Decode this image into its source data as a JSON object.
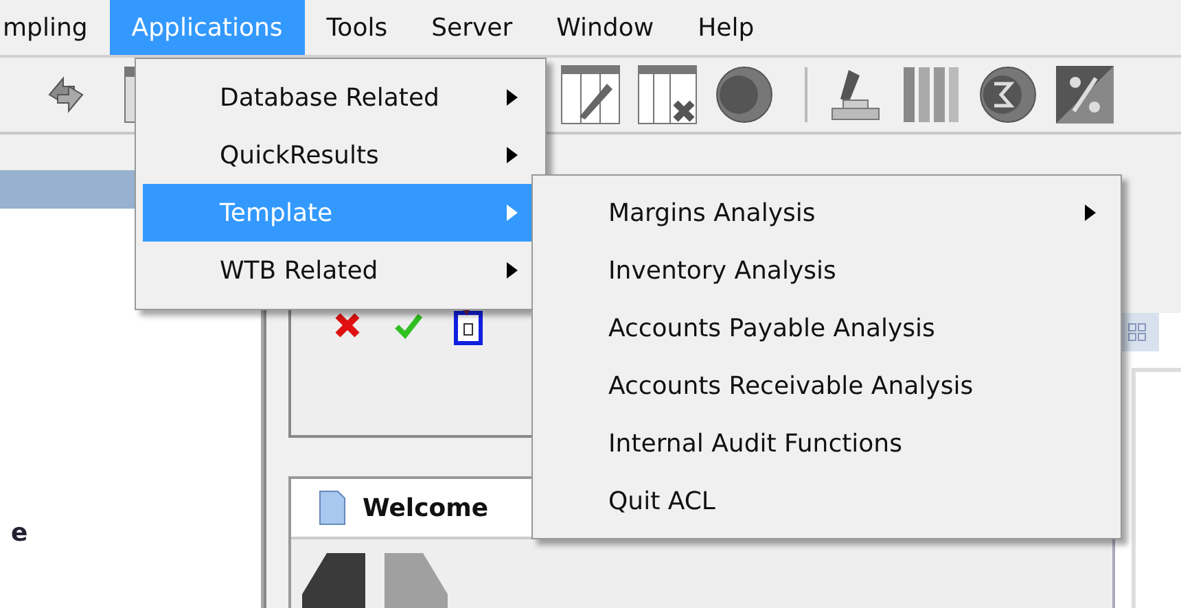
{
  "menubar": [
    {
      "label": "mpling",
      "selected": false
    },
    {
      "label": "Applications",
      "selected": true
    },
    {
      "label": "Tools",
      "selected": false
    },
    {
      "label": "Server",
      "selected": false
    },
    {
      "label": "Window",
      "selected": false
    },
    {
      "label": "Help",
      "selected": false
    }
  ],
  "applications_menu": [
    {
      "label": "Database Related",
      "selected": false,
      "has_submenu": true
    },
    {
      "label": "QuickResults",
      "selected": false,
      "has_submenu": true
    },
    {
      "label": "Template",
      "selected": true,
      "has_submenu": true
    },
    {
      "label": "WTB Related",
      "selected": false,
      "has_submenu": true
    }
  ],
  "template_submenu": [
    {
      "label": "Margins Analysis",
      "has_submenu": true
    },
    {
      "label": "Inventory Analysis",
      "has_submenu": false
    },
    {
      "label": "Accounts Payable Analysis",
      "has_submenu": false
    },
    {
      "label": "Accounts Receivable Analysis",
      "has_submenu": false
    },
    {
      "label": "Internal Audit Functions",
      "has_submenu": false
    },
    {
      "label": "Quit ACL",
      "has_submenu": false
    }
  ],
  "left_panel": {
    "text": "e"
  },
  "welcome_tab": {
    "label": "Welcome"
  }
}
